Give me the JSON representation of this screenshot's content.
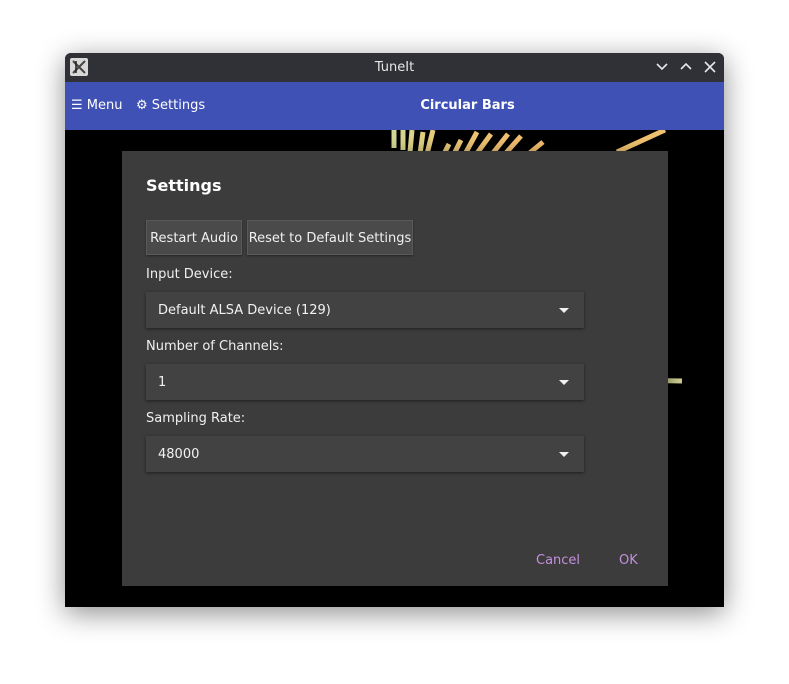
{
  "window": {
    "title": "TuneIt"
  },
  "appbar": {
    "menu_label": "☰ Menu",
    "settings_label": "⚙ Settings",
    "title": "Circular Bars",
    "color": "#3f51b5"
  },
  "visualizer": {
    "bar_color": "#e8c878"
  },
  "dialog": {
    "title": "Settings",
    "restart_audio_label": "Restart Audio",
    "reset_defaults_label": "Reset to Default Settings",
    "input_device": {
      "label": "Input Device:",
      "value": "Default ALSA Device (129)"
    },
    "channels": {
      "label": "Number of Channels:",
      "value": "1"
    },
    "sampling_rate": {
      "label": "Sampling Rate:",
      "value": "48000"
    },
    "cancel_label": "Cancel",
    "ok_label": "OK",
    "accent_color": "#c38fdc"
  }
}
